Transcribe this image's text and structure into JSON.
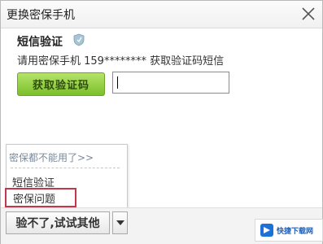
{
  "dialog": {
    "title": "更换密保手机"
  },
  "sms": {
    "title": "短信验证",
    "description": "请用密保手机 159******** 获取验证码短信",
    "get_code_label": "获取验证码",
    "code_value": ""
  },
  "dropdown": {
    "header": "密保都不能用了>>",
    "options": [
      "短信验证",
      "密保问题"
    ],
    "selected_index": 1
  },
  "footer": {
    "switch_label": "验不了,试试其他"
  },
  "watermark": {
    "text": "快捷下载网"
  },
  "colors": {
    "accent_green": "#8ccd3b",
    "highlight_red": "#c2374a",
    "header_gray_blue": "#7a8a9a"
  },
  "icons": {
    "close": "close-icon",
    "shield": "shield-icon",
    "dropdown_arrow": "chevron-down-icon",
    "watermark_logo": "watermark-logo-icon"
  }
}
